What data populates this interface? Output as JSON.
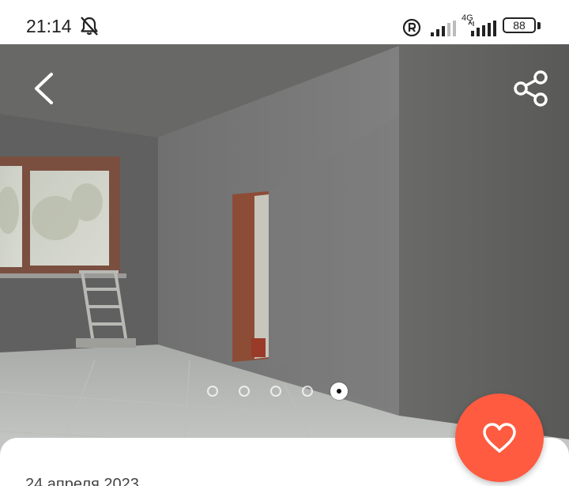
{
  "status_bar": {
    "time": "21:14",
    "network_type": "4G",
    "battery": "88",
    "icons": [
      "bell-off-icon",
      "registered-icon",
      "signal-icon",
      "signal-4g-icon",
      "battery-icon"
    ]
  },
  "gallery": {
    "photo_count": 5,
    "active_index": 4,
    "icons": [
      "chevron-left-icon",
      "share-icon"
    ]
  },
  "listing": {
    "date": "24 апреля 2023"
  },
  "favorite": {
    "icon": "heart-outline-icon",
    "color": "#ff5b41"
  }
}
